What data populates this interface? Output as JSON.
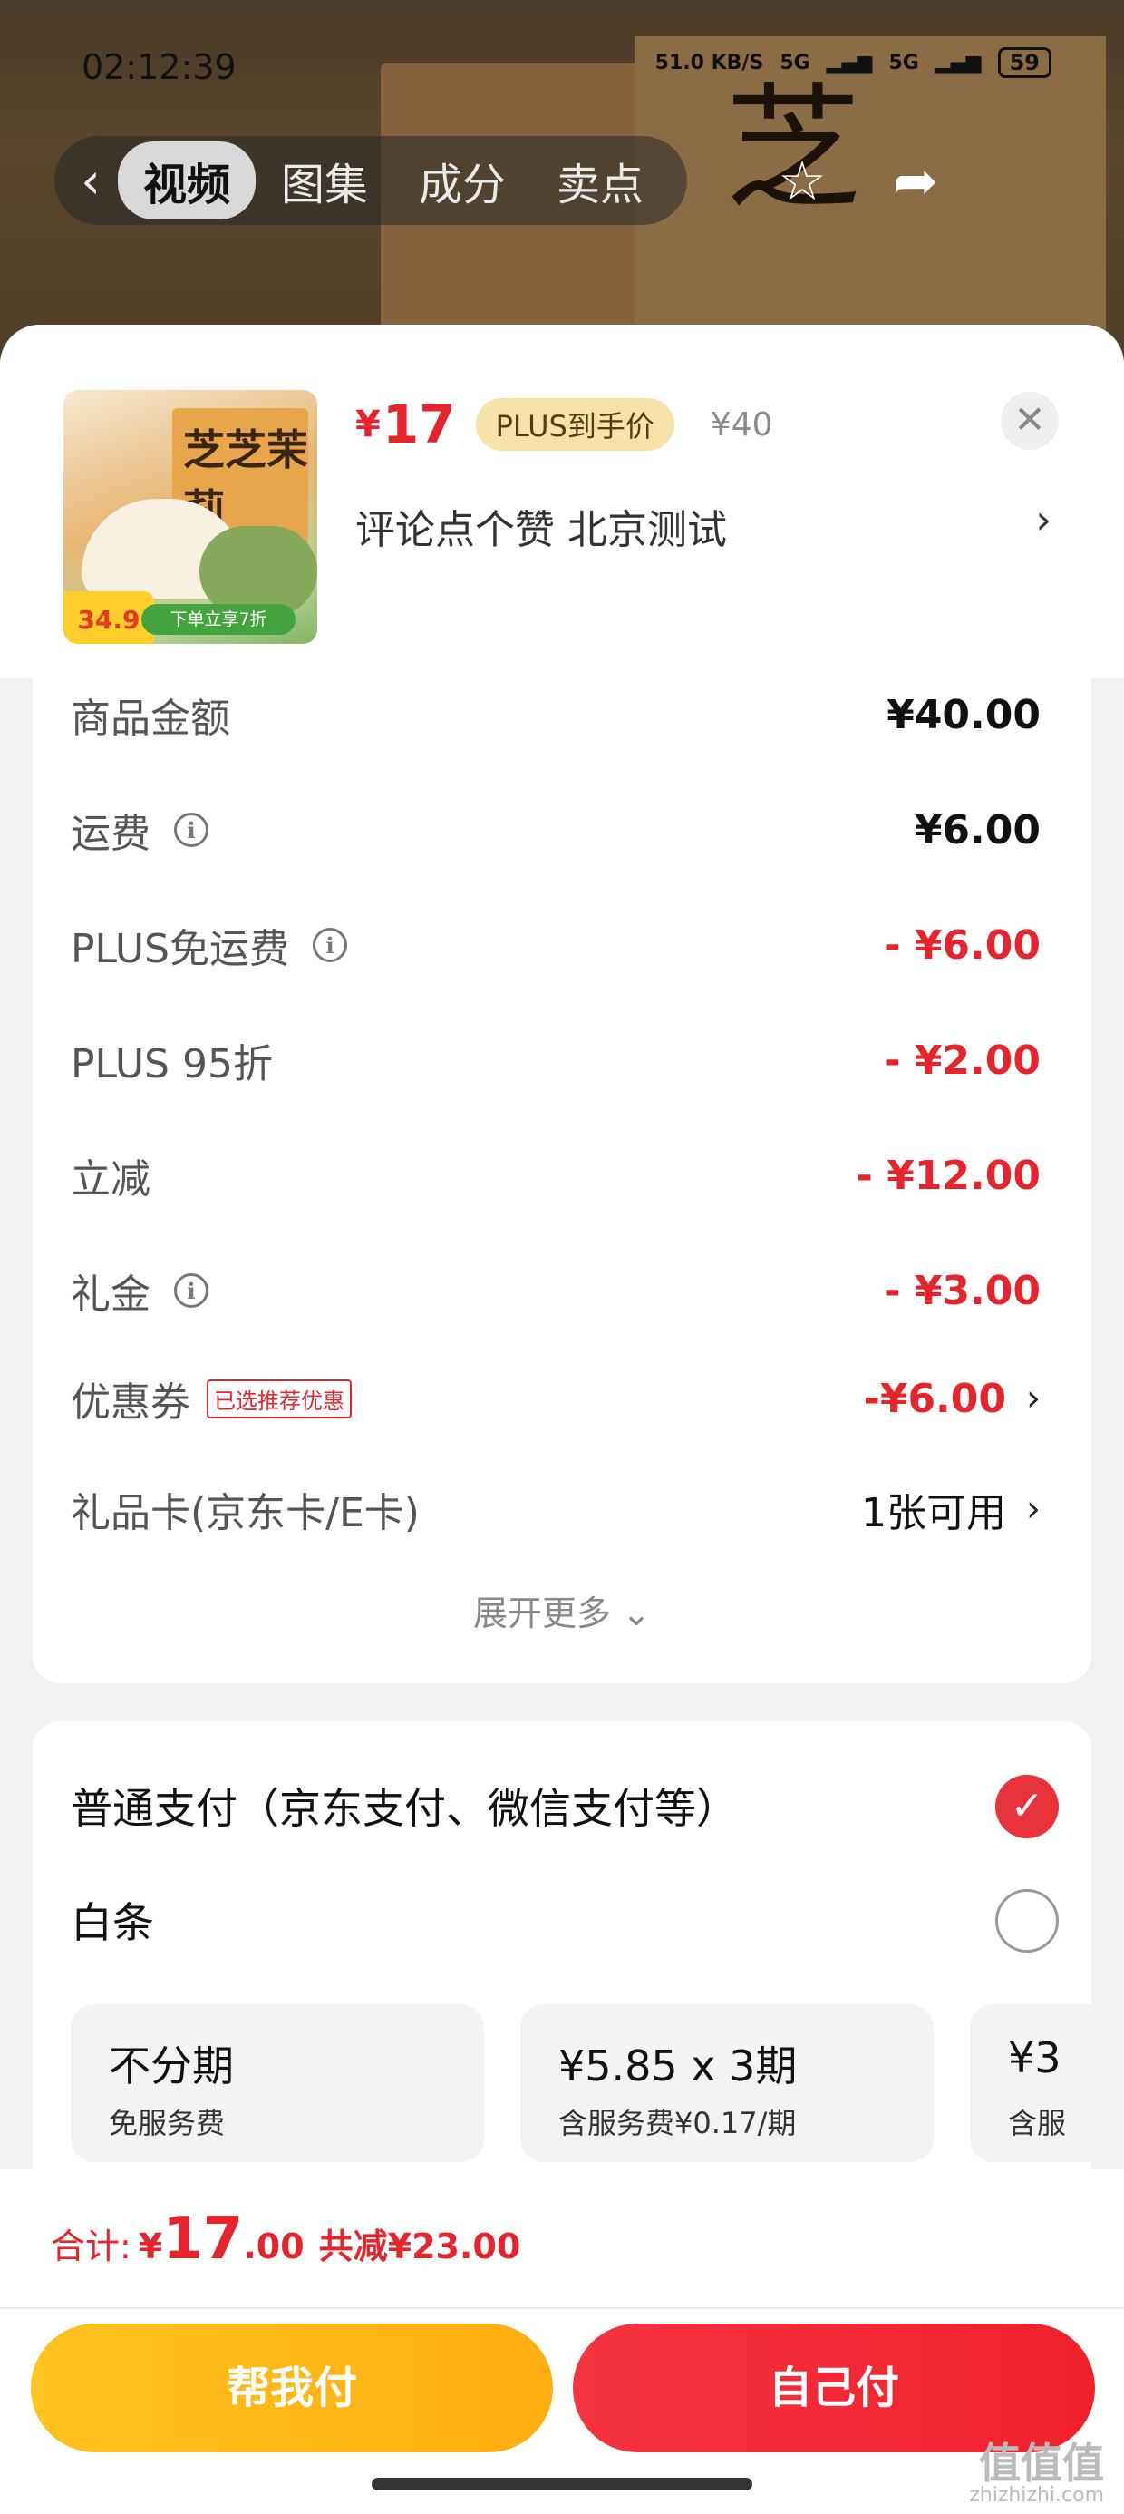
{
  "status_bar": {
    "time": "02:12:39",
    "net_speed": "51.0 KB/S",
    "network_1": "5G",
    "network_2": "5G",
    "battery": "59"
  },
  "media_tabs": {
    "back_icon": "chevron-left",
    "tabs": [
      "视频",
      "图集",
      "成分",
      "卖点"
    ]
  },
  "product": {
    "price_symbol": "¥",
    "price": "17",
    "plus_tag": "PLUS到手价",
    "original_price": "¥40",
    "title": "评论点个赞 北京测试",
    "thumb_pkg_text": "芝芝茉莉",
    "thumb_price": "34.9",
    "thumb_cta": "下单立享7折"
  },
  "price_details": [
    {
      "label": "商品金额",
      "value": "¥40.00",
      "info": false,
      "red": false
    },
    {
      "label": "运费",
      "value": "¥6.00",
      "info": true,
      "red": false
    },
    {
      "label": "PLUS免运费",
      "value": "- ¥6.00",
      "info": true,
      "red": true
    },
    {
      "label": "PLUS 95折",
      "value": "- ¥2.00",
      "info": false,
      "red": true
    },
    {
      "label": "立减",
      "value": "- ¥12.00",
      "info": false,
      "red": true
    },
    {
      "label": "礼金",
      "value": "- ¥3.00",
      "info": true,
      "red": true
    },
    {
      "label": "优惠券",
      "tag": "已选推荐优惠",
      "value": "-¥6.00",
      "red": true
    },
    {
      "label": "礼品卡(京东卡/E卡)",
      "value": "1张可用",
      "red": false
    }
  ],
  "expand_more": "展开更多",
  "payment": {
    "options": [
      {
        "label": "普通支付（京东支付、微信支付等）",
        "selected": true
      },
      {
        "label": "白条",
        "selected": false
      }
    ],
    "plans": [
      {
        "title": "不分期",
        "sub": "免服务费"
      },
      {
        "title": "¥5.85 x 3期",
        "sub": "含服务费¥0.17/期"
      },
      {
        "title": "¥3",
        "sub": "含服"
      }
    ]
  },
  "footer": {
    "total_label": "合计:",
    "total_symbol": "¥",
    "total_int": "17",
    "total_dec": ".00",
    "saved": "共减¥23.00",
    "help_pay": "帮我付",
    "self_pay": "自己付"
  },
  "watermark": {
    "main": "值值值",
    "sub": "zhizhizhi.com"
  },
  "colors": {
    "accent_red": "#e5242b",
    "help_yellow": "#ffb414",
    "plus_tag_bg": "#f6e3a8"
  }
}
